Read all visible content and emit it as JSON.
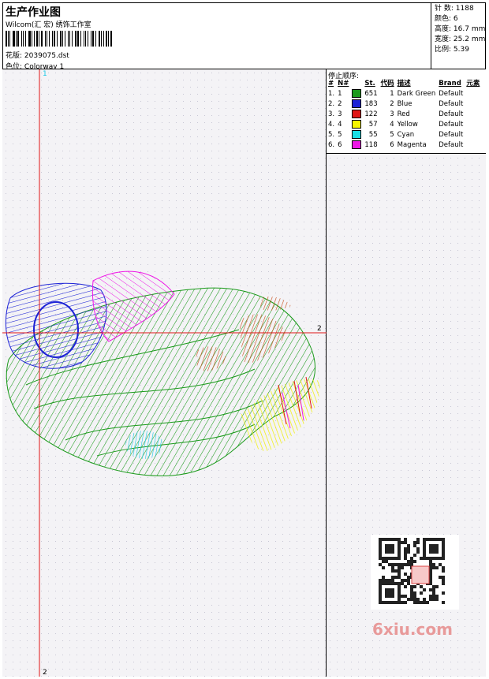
{
  "header": {
    "title": "生产作业图",
    "company": "Wilcom(汇 宏) 绣饰工作室",
    "design_label": "花版:",
    "design_value": "2039075.dst",
    "colorway_label": "色位:",
    "colorway_value": "Colorway 1"
  },
  "stats": [
    {
      "label": "针 数:",
      "value": "1188"
    },
    {
      "label": "颜色:",
      "value": "6"
    },
    {
      "label": "高度:",
      "value": "16.7 mm"
    },
    {
      "label": "宽度:",
      "value": "25.2 mm"
    },
    {
      "label": "比例:",
      "value": "5.39"
    }
  ],
  "axes": {
    "v_top": "1",
    "v_bottom": "2",
    "h_right": "2"
  },
  "stop_sequence": {
    "title": "停止顺序:",
    "columns": [
      "#",
      "N#",
      "St.",
      "代码",
      "描述",
      "Brand",
      "元素"
    ],
    "rows": [
      {
        "idx": "1.",
        "n": "1",
        "color": "#1a9a1a",
        "st": "651",
        "code": "1",
        "desc": "Dark Green",
        "brand": "Default"
      },
      {
        "idx": "2.",
        "n": "2",
        "color": "#1c22d6",
        "st": "183",
        "code": "2",
        "desc": "Blue",
        "brand": "Default"
      },
      {
        "idx": "3.",
        "n": "3",
        "color": "#e01616",
        "st": "122",
        "code": "3",
        "desc": "Red",
        "brand": "Default"
      },
      {
        "idx": "4.",
        "n": "4",
        "color": "#f5f500",
        "st": "57",
        "code": "4",
        "desc": "Yellow",
        "brand": "Default"
      },
      {
        "idx": "5.",
        "n": "5",
        "color": "#19e0e6",
        "st": "55",
        "code": "5",
        "desc": "Cyan",
        "brand": "Default"
      },
      {
        "idx": "6.",
        "n": "6",
        "color": "#ee18e6",
        "st": "118",
        "code": "6",
        "desc": "Magenta",
        "brand": "Default"
      }
    ]
  },
  "watermark": "6xiu.com"
}
